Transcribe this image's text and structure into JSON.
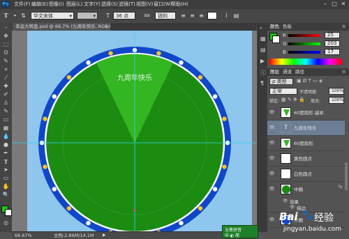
{
  "menubar": {
    "logo": "Ps",
    "items": [
      "文件(F)",
      "编辑(E)",
      "图像(I)",
      "图层(L)",
      "文字(Y)",
      "选择(S)",
      "滤镜(T)",
      "视图(V)",
      "窗口(W)",
      "帮助(H)"
    ]
  },
  "options": {
    "font_family": "华文宋体",
    "font_size": "36 点",
    "antialias": "锐利"
  },
  "document": {
    "tab_title": "幸运大转盘.psd @ 66.7% (九周年快乐, RGB/8) *",
    "canvas_text": "九周年快乐"
  },
  "panel": {
    "color_tabs": [
      "颜色",
      "色板"
    ],
    "r_label": "R",
    "r_value": "25",
    "g_label": "G",
    "g_value": "203",
    "b_label": "B",
    "b_value": "17",
    "layers_tabs": [
      "图层",
      "通道",
      "路径"
    ],
    "kind_label": "类型",
    "blend_mode": "正常",
    "opacity_label": "不透明度:",
    "opacity_value": "100%",
    "lock_label": "锁定:",
    "fill_label": "填充:",
    "fill_value": "100%",
    "layers": [
      {
        "name": "60度扇形 副本"
      },
      {
        "name": "九周年快乐"
      },
      {
        "name": "60度扇形"
      },
      {
        "name": "黄色圆点"
      },
      {
        "name": "白色圆点"
      },
      {
        "name": "中圈"
      },
      {
        "name": "效果"
      },
      {
        "name": "描边"
      },
      {
        "name": "外圈"
      }
    ]
  },
  "status": {
    "zoom": "66.67%",
    "doc_info": "文档:2.86M/14.1M"
  },
  "ime": {
    "line1": "五笔拼音",
    "line2": "中 ◐ 简"
  },
  "watermark": {
    "brand": "Bai",
    "brand_cn": "经验",
    "url": "jingyan.baidu.com"
  },
  "colors": {
    "wheel_blue": "#1047c8",
    "wheel_green": "#1b8b12",
    "sector_green": "#34b622",
    "background_blue": "#8ec6ee",
    "fg_swatch": "#19cb11"
  }
}
